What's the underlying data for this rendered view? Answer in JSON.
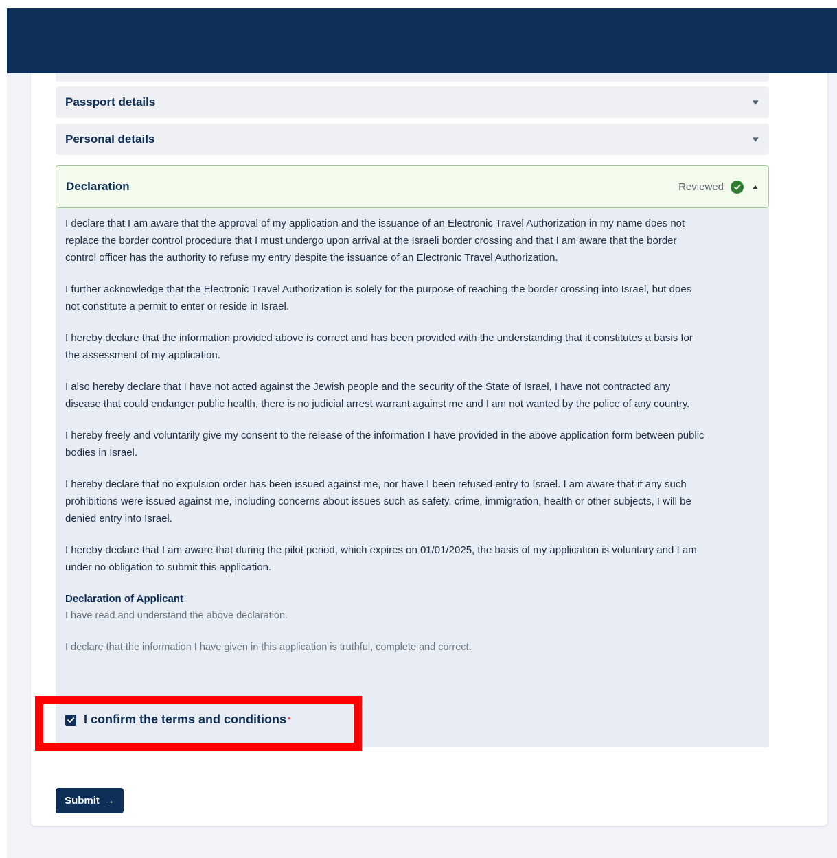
{
  "sections": {
    "passport": {
      "title": "Passport details",
      "chevron": "▾"
    },
    "personal": {
      "title": "Personal details",
      "chevron": "▾"
    },
    "declaration": {
      "title": "Declaration",
      "status": "Reviewed",
      "status_icon": "check-circle-icon",
      "chevron": "▴"
    }
  },
  "declaration": {
    "paragraphs": [
      "I declare that I am aware that the approval of my application and the issuance of an Electronic Travel Authorization in my name does not replace the border control procedure that I must undergo upon arrival at the Israeli border crossing and that I am aware that the border control officer has the authority to refuse my entry despite the issuance of an Electronic Travel Authorization.",
      "I further acknowledge that the Electronic Travel Authorization is solely for the purpose of reaching the border crossing into Israel, but does not constitute a permit to enter or reside in Israel.",
      "I hereby declare that the information provided above is correct and has been provided with the understanding that it constitutes a basis for the assessment of my application.",
      "I also hereby declare that I have not acted against the Jewish people and the security of the State of Israel, I have not contracted any disease that could endanger public health, there is no judicial arrest warrant against me and I am not wanted by the police of any country.",
      "I hereby freely and voluntarily give my consent to the release of the information I have provided in the above application form between public bodies in Israel.",
      "I hereby declare that no expulsion order has been issued against me, nor have I been refused entry to Israel. I am aware that if any such prohibitions were issued against me, including concerns about issues such as safety, crime, immigration, health or other subjects, I will be denied entry into Israel.",
      "I hereby declare that I am aware that during the pilot period, which expires on 01/01/2025, the basis of my application is voluntary and I am under no obligation to submit this application."
    ],
    "applicant_title": "Declaration of Applicant",
    "applicant_line1": "I have read and understand the above declaration.",
    "applicant_line2": "I declare that the information I have given in this application is truthful, complete and correct.",
    "confirm_label": "I confirm the terms and conditions",
    "confirm_required": "*",
    "confirm_checked": true
  },
  "submit": {
    "label": "Submit",
    "icon": "arrow-right-icon",
    "glyph": "→"
  },
  "colors": {
    "header": "#0e2f57",
    "accent": "#0e2f57",
    "reviewed_green": "#2e7d32",
    "highlight": "#ff0000"
  }
}
